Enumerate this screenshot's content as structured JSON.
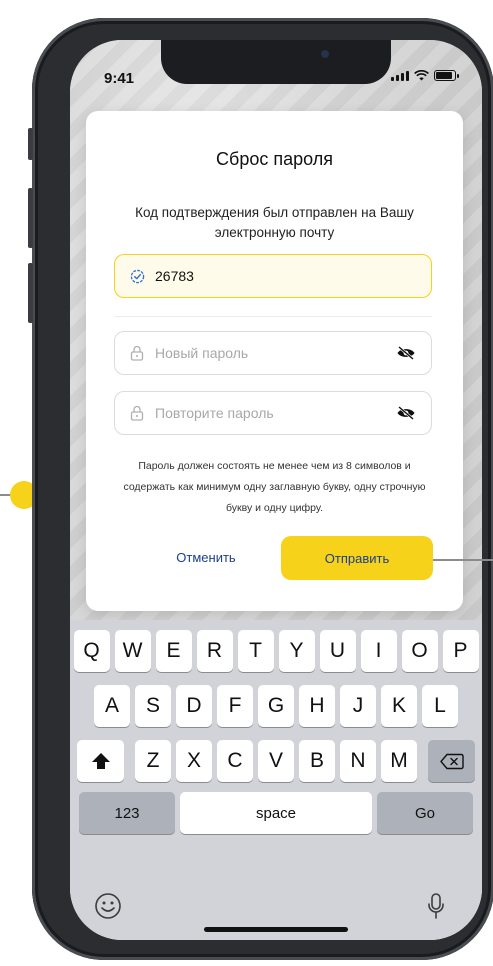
{
  "status_bar": {
    "time": "9:41"
  },
  "dialog": {
    "title": "Сброс пароля",
    "subtitle": "Код подтверждения был отправлен на Вашу электронную почту",
    "code_value": "26783",
    "new_password_placeholder": "Новый пароль",
    "repeat_password_placeholder": "Повторите пароль",
    "hint": "Пароль должен состоять не менее чем из 8 символов и содержать как минимум одну заглавную букву, одну строчную букву и одну цифру.",
    "cancel_label": "Отменить",
    "submit_label": "Отправить"
  },
  "keyboard": {
    "row1": [
      "Q",
      "W",
      "E",
      "R",
      "T",
      "Y",
      "U",
      "I",
      "O",
      "P"
    ],
    "row2": [
      "A",
      "S",
      "D",
      "F",
      "G",
      "H",
      "J",
      "K",
      "L"
    ],
    "row3": [
      "Z",
      "X",
      "C",
      "V",
      "B",
      "N",
      "M"
    ],
    "numbers_label": "123",
    "space_label": "space",
    "go_label": "Go"
  },
  "colors": {
    "accent": "#F7D21A",
    "link": "#1C3F8C",
    "keyboard_bg": "#D1D3D9"
  },
  "icons": [
    "check-badge-icon",
    "lock-icon",
    "eye-off-icon",
    "shift-icon",
    "backspace-icon",
    "emoji-icon",
    "microphone-icon"
  ]
}
